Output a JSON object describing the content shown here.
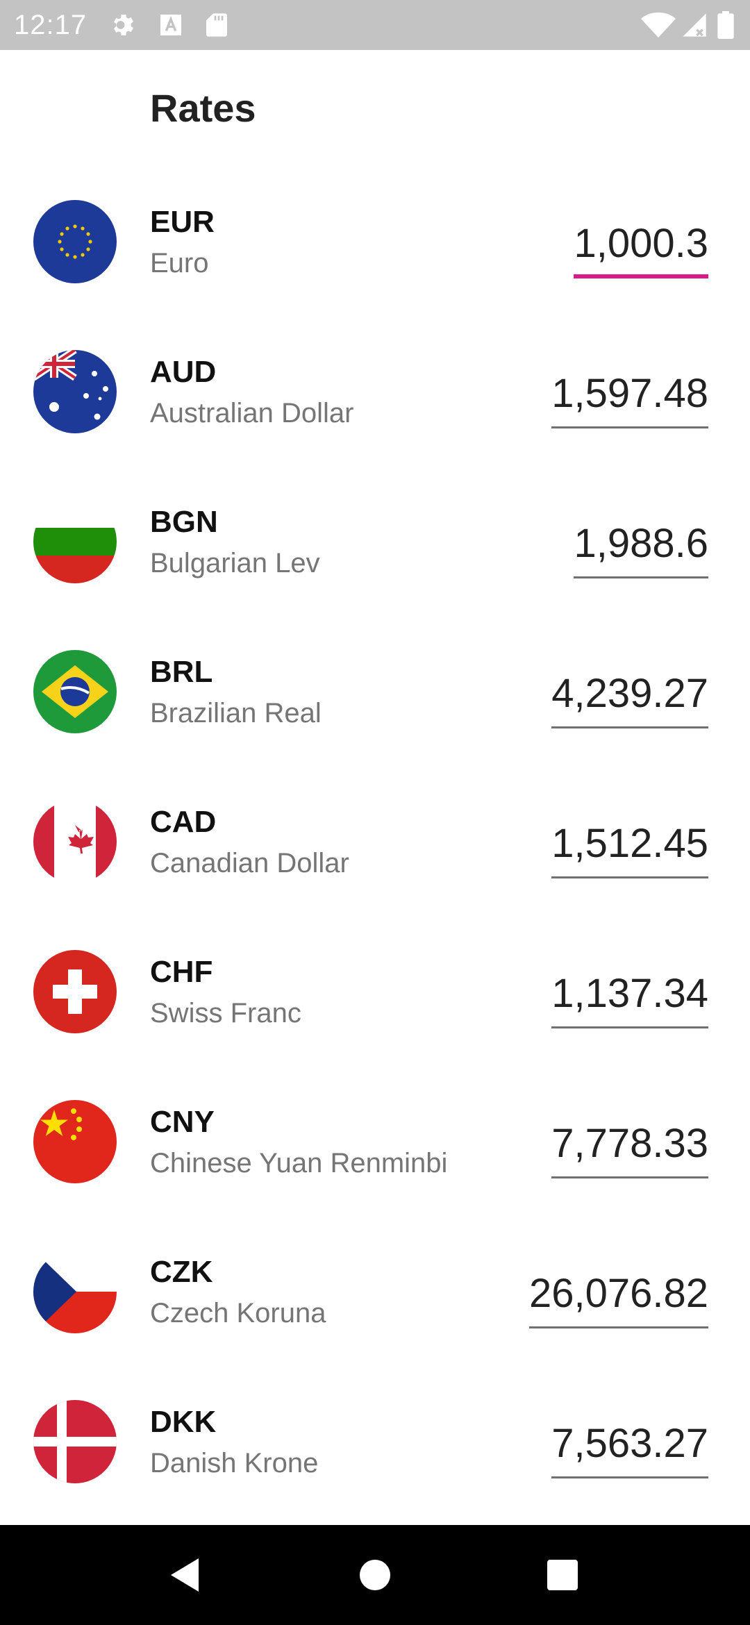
{
  "status_bar": {
    "time": "12:17",
    "icons": [
      "gear-icon",
      "a-text-icon",
      "sd-card-icon",
      "wifi-icon",
      "signal-icon",
      "battery-icon"
    ]
  },
  "header": {
    "title": "Rates"
  },
  "colors": {
    "accent_underline": "#d81b8a",
    "status_bar_bg": "#c3c3c3",
    "nav_bar_bg": "#000000",
    "secondary_text": "#757575"
  },
  "rates": [
    {
      "code": "EUR",
      "name": "Euro",
      "value": "1,000.3",
      "flag_icon": "eu-flag-icon",
      "active": true
    },
    {
      "code": "AUD",
      "name": "Australian Dollar",
      "value": "1,597.48",
      "flag_icon": "australia-flag-icon",
      "active": false
    },
    {
      "code": "BGN",
      "name": "Bulgarian Lev",
      "value": "1,988.6",
      "flag_icon": "bulgaria-flag-icon",
      "active": false
    },
    {
      "code": "BRL",
      "name": "Brazilian Real",
      "value": "4,239.27",
      "flag_icon": "brazil-flag-icon",
      "active": false
    },
    {
      "code": "CAD",
      "name": "Canadian Dollar",
      "value": "1,512.45",
      "flag_icon": "canada-flag-icon",
      "active": false
    },
    {
      "code": "CHF",
      "name": "Swiss Franc",
      "value": "1,137.34",
      "flag_icon": "switzerland-flag-icon",
      "active": false
    },
    {
      "code": "CNY",
      "name": "Chinese Yuan Renminbi",
      "value": "7,778.33",
      "flag_icon": "china-flag-icon",
      "active": false
    },
    {
      "code": "CZK",
      "name": "Czech Koruna",
      "value": "26,076.82",
      "flag_icon": "czech-flag-icon",
      "active": false
    },
    {
      "code": "DKK",
      "name": "Danish Krone",
      "value": "7,563.27",
      "flag_icon": "denmark-flag-icon",
      "active": false
    }
  ],
  "nav_bar": {
    "icons": [
      "back-icon",
      "home-icon",
      "recents-icon"
    ]
  }
}
